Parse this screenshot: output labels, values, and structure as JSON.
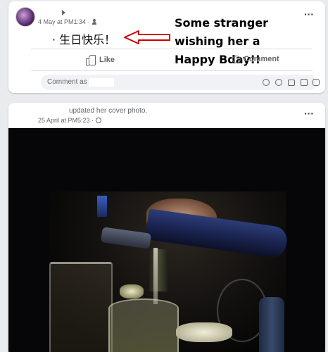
{
  "post1": {
    "timestamp": "4 May at PM1:34 ·",
    "audience_icon": "friends-icon",
    "text": "· 生日快乐！",
    "annotation": "Some stranger wishing her a Happy Bday!!",
    "annotation_color": "#cc0000",
    "actions": {
      "like": "Like",
      "comment": "Comment"
    },
    "comment_placeholder": "Comment as"
  },
  "post2": {
    "action_text": "updated her cover photo.",
    "timestamp": "25 April at PM5:23 ·",
    "audience_icon": "globe-icon"
  },
  "more_icon": "more-options-icon"
}
